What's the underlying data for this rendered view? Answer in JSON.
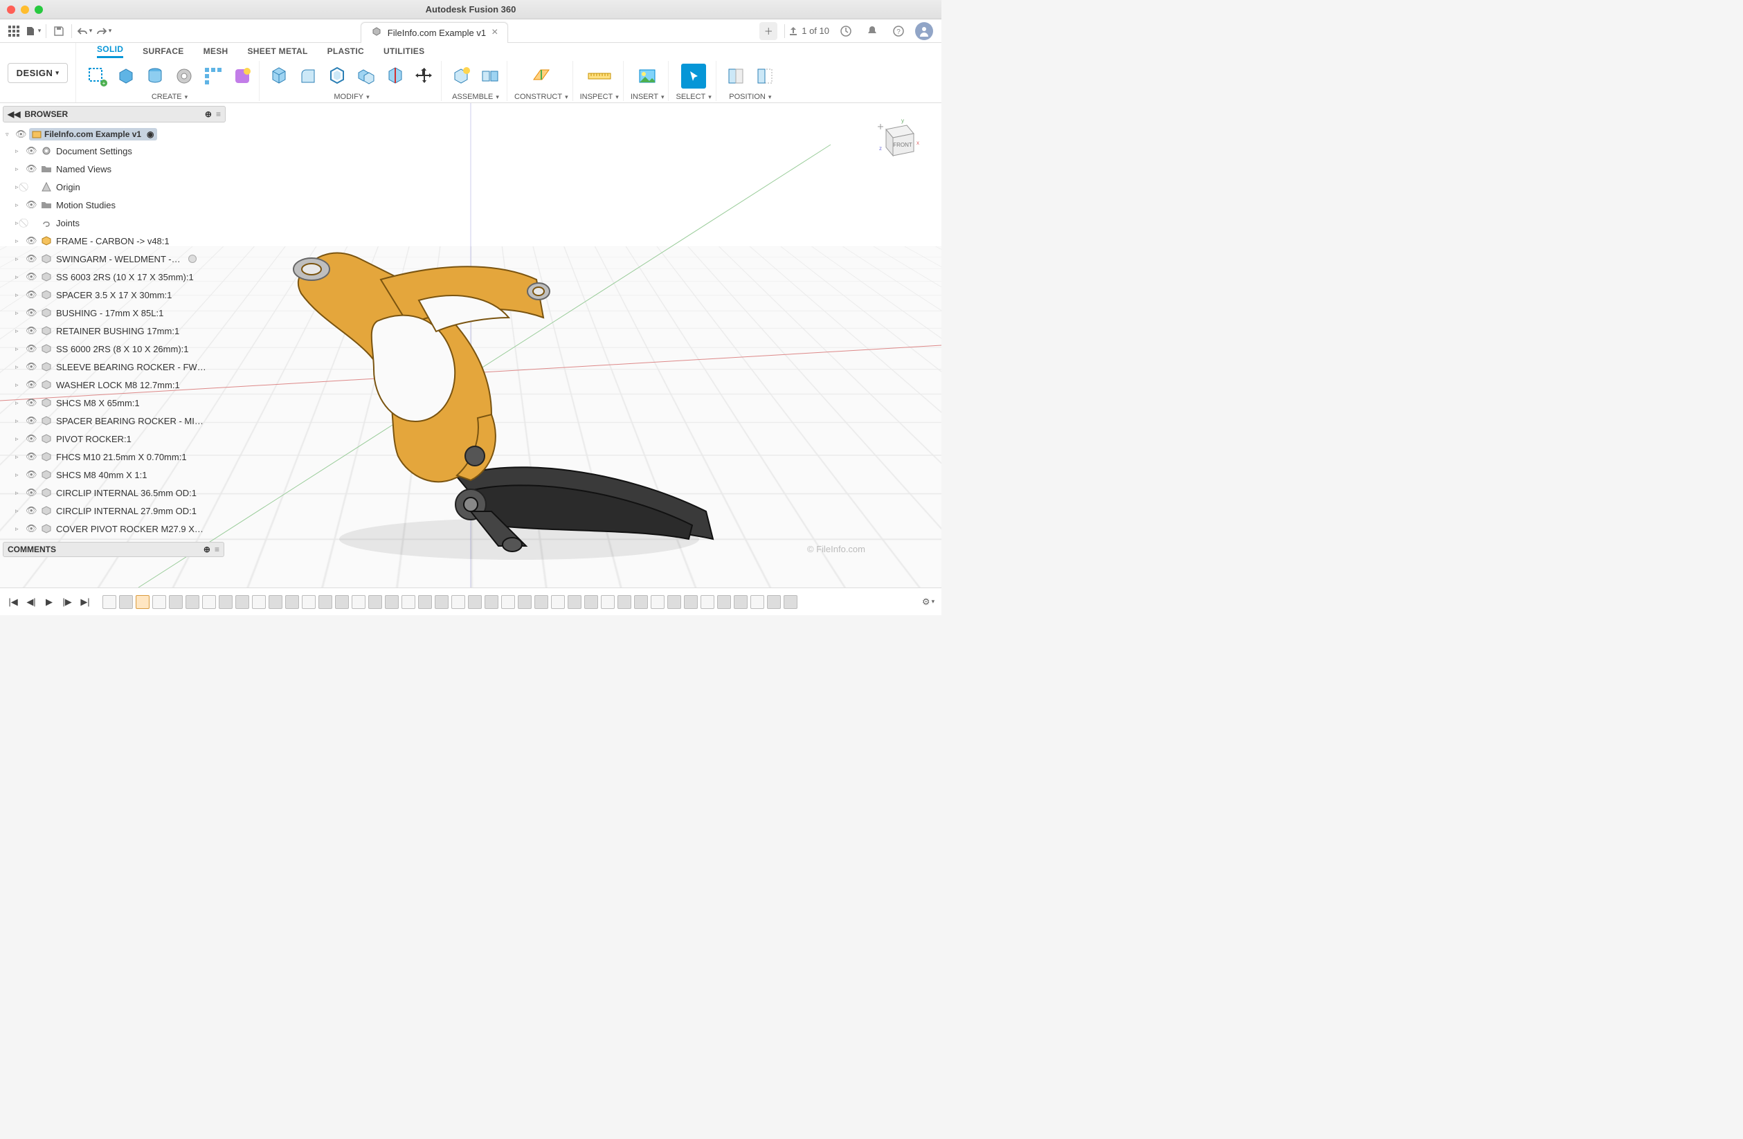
{
  "window": {
    "title": "Autodesk Fusion 360"
  },
  "qat": {
    "job_status": "1 of 10"
  },
  "doc_tab": {
    "title": "FileInfo.com Example v1"
  },
  "workspace": {
    "label": "DESIGN"
  },
  "ribbon_tabs": [
    "SOLID",
    "SURFACE",
    "MESH",
    "SHEET METAL",
    "PLASTIC",
    "UTILITIES"
  ],
  "ribbon_active": "SOLID",
  "ribbon_groups": {
    "create": "CREATE",
    "modify": "MODIFY",
    "assemble": "ASSEMBLE",
    "construct": "CONSTRUCT",
    "inspect": "INSPECT",
    "insert": "INSERT",
    "select": "SELECT",
    "position": "POSITION"
  },
  "browser": {
    "header": "BROWSER",
    "root": "FileInfo.com Example v1",
    "nodes": [
      {
        "icon": "gear",
        "label": "Document Settings"
      },
      {
        "icon": "folder",
        "label": "Named Views"
      },
      {
        "icon": "origin",
        "label": "Origin",
        "hidden": true
      },
      {
        "icon": "folder",
        "label": "Motion Studies"
      },
      {
        "icon": "link",
        "label": "Joints",
        "hidden": true
      },
      {
        "icon": "comp-a",
        "label": "FRAME - CARBON -> v48:1"
      },
      {
        "icon": "comp",
        "label": "SWINGARM - WELDMENT -…",
        "trail": true
      },
      {
        "icon": "comp",
        "label": "SS 6003 2RS (10 X 17 X 35mm):1"
      },
      {
        "icon": "comp",
        "label": "SPACER 3.5 X 17 X 30mm:1"
      },
      {
        "icon": "comp",
        "label": "BUSHING - 17mm X 85L:1"
      },
      {
        "icon": "comp",
        "label": "RETAINER BUSHING 17mm:1"
      },
      {
        "icon": "comp",
        "label": "SS 6000 2RS (8 X 10 X 26mm):1"
      },
      {
        "icon": "comp",
        "label": "SLEEVE BEARING ROCKER - FW…"
      },
      {
        "icon": "comp",
        "label": "WASHER LOCK M8 12.7mm:1"
      },
      {
        "icon": "comp",
        "label": "SHCS M8 X 65mm:1"
      },
      {
        "icon": "comp",
        "label": "SPACER BEARING ROCKER - MI…"
      },
      {
        "icon": "comp",
        "label": "PIVOT ROCKER:1"
      },
      {
        "icon": "comp",
        "label": "FHCS M10 21.5mm X 0.70mm:1"
      },
      {
        "icon": "comp",
        "label": "SHCS M8 40mm X 1:1"
      },
      {
        "icon": "comp",
        "label": "CIRCLIP INTERNAL 36.5mm OD:1"
      },
      {
        "icon": "comp",
        "label": "CIRCLIP INTERNAL 27.9mm OD:1"
      },
      {
        "icon": "comp",
        "label": "COVER PIVOT ROCKER M27.9 X…"
      }
    ]
  },
  "comments": {
    "header": "COMMENTS"
  },
  "viewcube": {
    "face": "FRONT",
    "x": "x",
    "y": "y",
    "z": "z"
  },
  "watermark": "© FileInfo.com",
  "timeline": {
    "feature_count": 42
  }
}
